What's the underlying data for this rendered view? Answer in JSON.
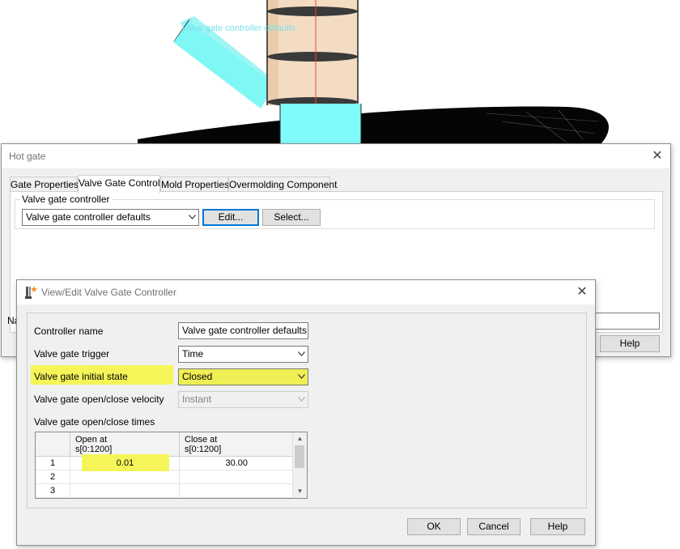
{
  "viewport": {
    "overlay_label": "Valve gate controller defaults",
    "colors": {
      "cyan": "#80ffff",
      "barrel": "#f5dfc0",
      "disk": "#000000",
      "label": "#7fe0e8"
    }
  },
  "hot_gate": {
    "title": "Hot gate",
    "close_glyph": "✕",
    "tabs": [
      {
        "label": "Gate Properties"
      },
      {
        "label": "Valve Gate Control"
      },
      {
        "label": "Mold Properties"
      },
      {
        "label": "Overmolding Component"
      }
    ],
    "group_label": "Valve gate controller",
    "controller_select": "Valve gate controller defaults",
    "edit_label": "Edit...",
    "select_label": "Select...",
    "name_label_partial": "Na",
    "help_label": "Help"
  },
  "vgc": {
    "title": "View/Edit Valve Gate Controller",
    "close_glyph": "✕",
    "fields": {
      "controller_name_label": "Controller name",
      "controller_name_value": "Valve gate controller defaults",
      "trigger_label": "Valve gate trigger",
      "trigger_value": "Time",
      "initial_state_label": "Valve gate initial state",
      "initial_state_value": "Closed",
      "velocity_label": "Valve gate open/close velocity",
      "velocity_value": "Instant",
      "times_label": "Valve gate open/close times"
    },
    "grid": {
      "col1_line1": "Open at",
      "col1_line2": "s[0:1200]",
      "col2_line1": "Close at",
      "col2_line2": "s[0:1200]",
      "rows": [
        {
          "index": "1",
          "open": "0.01",
          "close": "30.00"
        },
        {
          "index": "2",
          "open": "",
          "close": ""
        },
        {
          "index": "3",
          "open": "",
          "close": ""
        }
      ]
    },
    "ok_label": "OK",
    "cancel_label": "Cancel",
    "help_label": "Help",
    "highlight_color": "#f5f55a"
  }
}
